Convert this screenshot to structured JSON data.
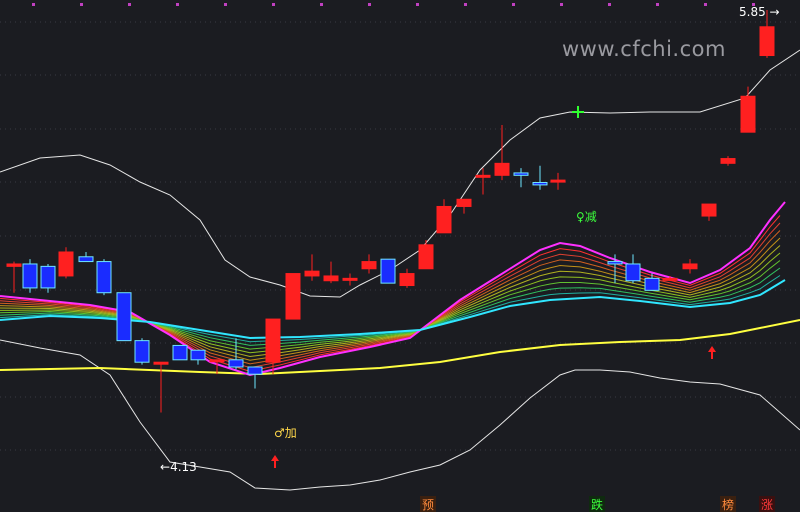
{
  "watermark": "www.cfchi.com",
  "price_high_label": "5.85",
  "price_low_label": "4.13",
  "signal_labels": {
    "add": "加",
    "reduce": "减"
  },
  "bottom_tags": [
    "预",
    "跌",
    "榜",
    "涨"
  ],
  "colors": {
    "background": "#1b1c21",
    "up": "#ff2020",
    "down": "#1a2cff",
    "down_edge": "#6ee6ff",
    "bollinger": "#e6e6e6",
    "ma_long": "#ffff40",
    "ma_pink": "#ff30ff",
    "ma_cyan": "#30e6ff"
  },
  "chart_data": {
    "type": "candlestick",
    "ylim": [
      3.95,
      5.92
    ],
    "candles": [
      {
        "o": 4.85,
        "h": 4.87,
        "l": 4.74,
        "c": 4.86
      },
      {
        "o": 4.86,
        "h": 4.88,
        "l": 4.74,
        "c": 4.76
      },
      {
        "o": 4.85,
        "h": 4.86,
        "l": 4.74,
        "c": 4.76
      },
      {
        "o": 4.81,
        "h": 4.93,
        "l": 4.8,
        "c": 4.91
      },
      {
        "o": 4.89,
        "h": 4.91,
        "l": 4.87,
        "c": 4.87
      },
      {
        "o": 4.87,
        "h": 4.88,
        "l": 4.73,
        "c": 4.74
      },
      {
        "o": 4.74,
        "h": 4.74,
        "l": 4.55,
        "c": 4.54
      },
      {
        "o": 4.54,
        "h": 4.55,
        "l": 4.44,
        "c": 4.45
      },
      {
        "o": 4.45,
        "h": 4.45,
        "l": 4.24,
        "c": 4.45
      },
      {
        "o": 4.52,
        "h": 4.52,
        "l": 4.46,
        "c": 4.46
      },
      {
        "o": 4.5,
        "h": 4.5,
        "l": 4.44,
        "c": 4.46
      },
      {
        "o": 4.46,
        "h": 4.46,
        "l": 4.4,
        "c": 4.46
      },
      {
        "o": 4.46,
        "h": 4.55,
        "l": 4.42,
        "c": 4.43
      },
      {
        "o": 4.43,
        "h": 4.43,
        "l": 4.34,
        "c": 4.4
      },
      {
        "o": 4.45,
        "h": 4.63,
        "l": 4.4,
        "c": 4.63
      },
      {
        "o": 4.63,
        "h": 4.82,
        "l": 4.63,
        "c": 4.82
      },
      {
        "o": 4.81,
        "h": 4.9,
        "l": 4.79,
        "c": 4.83
      },
      {
        "o": 4.79,
        "h": 4.87,
        "l": 4.78,
        "c": 4.81
      },
      {
        "o": 4.8,
        "h": 4.82,
        "l": 4.77,
        "c": 4.8
      },
      {
        "o": 4.84,
        "h": 4.9,
        "l": 4.82,
        "c": 4.87
      },
      {
        "o": 4.88,
        "h": 4.88,
        "l": 4.78,
        "c": 4.78
      },
      {
        "o": 4.77,
        "h": 4.84,
        "l": 4.76,
        "c": 4.82
      },
      {
        "o": 4.84,
        "h": 4.96,
        "l": 4.84,
        "c": 4.94
      },
      {
        "o": 4.99,
        "h": 5.13,
        "l": 4.99,
        "c": 5.1
      },
      {
        "o": 5.1,
        "h": 5.13,
        "l": 5.07,
        "c": 5.13
      },
      {
        "o": 5.23,
        "h": 5.26,
        "l": 5.15,
        "c": 5.23
      },
      {
        "o": 5.23,
        "h": 5.44,
        "l": 5.21,
        "c": 5.28
      },
      {
        "o": 5.24,
        "h": 5.26,
        "l": 5.18,
        "c": 5.23
      },
      {
        "o": 5.2,
        "h": 5.27,
        "l": 5.17,
        "c": 5.19
      },
      {
        "o": 5.21,
        "h": 5.24,
        "l": 5.17,
        "c": 5.21
      },
      {
        "o": 4.87,
        "h": 4.9,
        "l": 4.78,
        "c": 4.86
      },
      {
        "o": 4.86,
        "h": 4.9,
        "l": 4.78,
        "c": 4.79
      },
      {
        "o": 4.8,
        "h": 4.82,
        "l": 4.75,
        "c": 4.75
      },
      {
        "o": 4.8,
        "h": 4.81,
        "l": 4.79,
        "c": 4.8
      },
      {
        "o": 4.84,
        "h": 4.88,
        "l": 4.82,
        "c": 4.86
      },
      {
        "o": 5.06,
        "h": 5.11,
        "l": 5.04,
        "c": 5.11
      },
      {
        "o": 5.28,
        "h": 5.31,
        "l": 5.27,
        "c": 5.3
      },
      {
        "o": 5.41,
        "h": 5.6,
        "l": 5.41,
        "c": 5.56
      },
      {
        "o": 5.73,
        "h": 5.92,
        "l": 5.72,
        "c": 5.85
      }
    ],
    "candle_x": [
      14,
      30,
      48,
      66,
      86,
      104,
      124,
      142,
      161,
      180,
      198,
      217,
      236,
      255,
      273,
      293,
      312,
      331,
      350,
      369,
      388,
      407,
      426,
      444,
      464,
      483,
      502,
      521,
      540,
      558,
      615,
      633,
      652,
      670,
      690,
      709,
      728,
      748,
      767,
      786
    ],
    "skip_index": 30,
    "bollinger_upper": [
      [
        0,
        172
      ],
      [
        40,
        158
      ],
      [
        80,
        155
      ],
      [
        110,
        165
      ],
      [
        140,
        182
      ],
      [
        170,
        195
      ],
      [
        200,
        220
      ],
      [
        225,
        260
      ],
      [
        250,
        277
      ],
      [
        280,
        285
      ],
      [
        310,
        296
      ],
      [
        340,
        297
      ],
      [
        360,
        285
      ],
      [
        390,
        270
      ],
      [
        420,
        250
      ],
      [
        450,
        215
      ],
      [
        480,
        170
      ],
      [
        510,
        140
      ],
      [
        540,
        118
      ],
      [
        570,
        112
      ],
      [
        610,
        113
      ],
      [
        650,
        112
      ],
      [
        700,
        112
      ],
      [
        745,
        98
      ],
      [
        770,
        70
      ],
      [
        800,
        50
      ]
    ],
    "bollinger_lower": [
      [
        0,
        340
      ],
      [
        40,
        348
      ],
      [
        80,
        355
      ],
      [
        110,
        375
      ],
      [
        140,
        422
      ],
      [
        170,
        462
      ],
      [
        200,
        467
      ],
      [
        230,
        472
      ],
      [
        255,
        488
      ],
      [
        290,
        490
      ],
      [
        320,
        487
      ],
      [
        350,
        485
      ],
      [
        380,
        480
      ],
      [
        410,
        472
      ],
      [
        440,
        465
      ],
      [
        470,
        450
      ],
      [
        500,
        425
      ],
      [
        530,
        398
      ],
      [
        560,
        375
      ],
      [
        575,
        370
      ],
      [
        600,
        370
      ],
      [
        630,
        372
      ],
      [
        660,
        378
      ],
      [
        690,
        382
      ],
      [
        720,
        384
      ],
      [
        760,
        395
      ],
      [
        800,
        430
      ]
    ],
    "ma_long": [
      [
        0,
        370
      ],
      [
        100,
        368
      ],
      [
        200,
        372
      ],
      [
        260,
        374
      ],
      [
        320,
        371
      ],
      [
        380,
        368
      ],
      [
        440,
        362
      ],
      [
        500,
        352
      ],
      [
        560,
        345
      ],
      [
        620,
        342
      ],
      [
        680,
        340
      ],
      [
        730,
        334
      ],
      [
        760,
        328
      ],
      [
        800,
        320
      ]
    ],
    "ma_pink": [
      [
        0,
        296
      ],
      [
        40,
        300
      ],
      [
        90,
        305
      ],
      [
        130,
        312
      ],
      [
        170,
        335
      ],
      [
        210,
        362
      ],
      [
        250,
        375
      ],
      [
        280,
        368
      ],
      [
        320,
        357
      ],
      [
        370,
        347
      ],
      [
        410,
        338
      ],
      [
        460,
        300
      ],
      [
        500,
        275
      ],
      [
        540,
        250
      ],
      [
        560,
        243
      ],
      [
        580,
        246
      ],
      [
        610,
        258
      ],
      [
        650,
        272
      ],
      [
        690,
        283
      ],
      [
        720,
        270
      ],
      [
        750,
        248
      ],
      [
        770,
        220
      ],
      [
        785,
        202
      ]
    ],
    "ma_cyan": [
      [
        0,
        320
      ],
      [
        50,
        316
      ],
      [
        100,
        318
      ],
      [
        150,
        322
      ],
      [
        200,
        330
      ],
      [
        250,
        338
      ],
      [
        300,
        337
      ],
      [
        360,
        334
      ],
      [
        420,
        330
      ],
      [
        470,
        317
      ],
      [
        510,
        306
      ],
      [
        550,
        300
      ],
      [
        600,
        297
      ],
      [
        640,
        301
      ],
      [
        690,
        307
      ],
      [
        730,
        303
      ],
      [
        760,
        295
      ],
      [
        785,
        280
      ]
    ],
    "ma_ribbon_count": 9,
    "signal_arrows": [
      {
        "x": 275,
        "y": 464
      },
      {
        "x": 712,
        "y": 355
      }
    ],
    "green_marker": {
      "x": 578,
      "y": 112
    }
  }
}
